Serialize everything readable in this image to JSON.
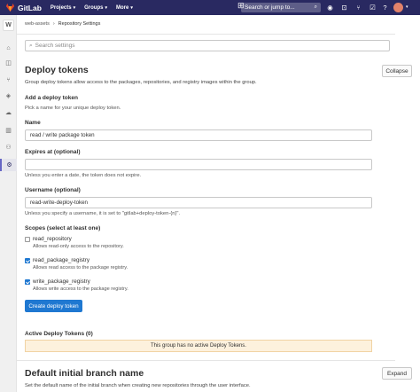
{
  "topbar": {
    "brand": "GitLab",
    "nav": [
      {
        "label": "Projects"
      },
      {
        "label": "Groups"
      },
      {
        "label": "More"
      }
    ],
    "search_placeholder": "Search or jump to...",
    "search_shortcut": "🔍",
    "icons": [
      "plus-icon",
      "broadcast-icon",
      "merge-request-icon",
      "todo-icon",
      "help-icon"
    ]
  },
  "sidebar": {
    "project_initial": "W",
    "items": [
      "group-overview-icon",
      "issues-icon",
      "merge-requests-icon",
      "security-icon",
      "kubernetes-icon",
      "analytics-icon",
      "members-icon",
      "settings-icon"
    ]
  },
  "breadcrumb": {
    "group": "web-assets",
    "current": "Repository Settings"
  },
  "settings_search": {
    "placeholder": "Search settings"
  },
  "deploy_tokens": {
    "title": "Deploy tokens",
    "description": "Group deploy tokens allow access to the packages, repositories, and registry images within the group.",
    "collapse_label": "Collapse",
    "add_title": "Add a deploy token",
    "add_description": "Pick a name for your unique deploy token.",
    "name_label": "Name",
    "name_value": "read / write package token",
    "expires_label": "Expires at (optional)",
    "expires_value": "",
    "expires_help": "Unless you enter a date, the token does not expire.",
    "username_label": "Username (optional)",
    "username_value": "read-write-deploy-token",
    "username_help": "Unless you specify a username, it is set to \"gitlab+deploy-token-{n}\".",
    "scopes_label": "Scopes (select at least one)",
    "scopes": [
      {
        "name": "read_repository",
        "help": "Allows read-only access to the repository.",
        "checked": false
      },
      {
        "name": "read_package_registry",
        "help": "Allows read access to the package registry.",
        "checked": true
      },
      {
        "name": "write_package_registry",
        "help": "Allows write access to the package registry.",
        "checked": true
      }
    ],
    "create_label": "Create deploy token",
    "active_title": "Active Deploy Tokens (0)",
    "empty_message": "This group has no active Deploy Tokens."
  },
  "default_branch": {
    "title": "Default initial branch name",
    "description": "Set the default name of the initial branch when creating new repositories through the user interface.",
    "expand_label": "Expand"
  },
  "colors": {
    "topbar": "#292961",
    "primary": "#1f78d1",
    "warning_bg": "#fdf1dd"
  }
}
